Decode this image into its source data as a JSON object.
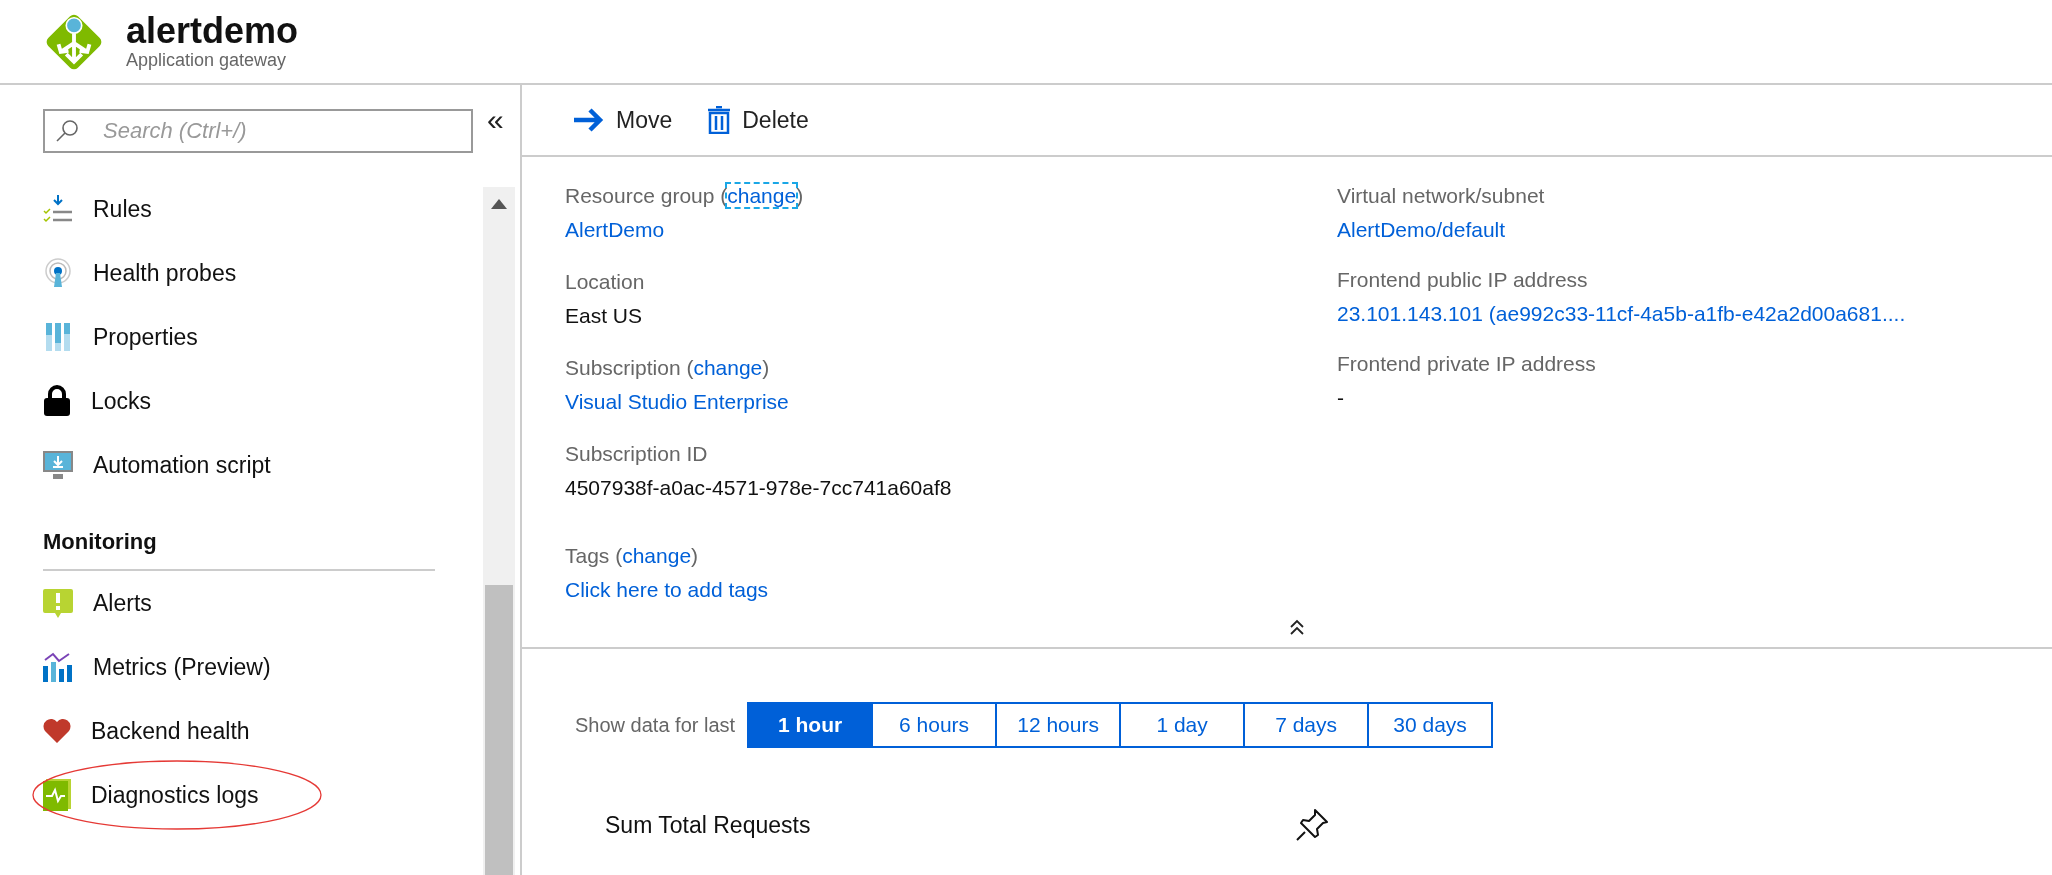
{
  "header": {
    "title": "alertdemo",
    "subtitle": "Application gateway"
  },
  "sidebar": {
    "search": {
      "placeholder": "Search (Ctrl+/)"
    },
    "collapse": "«",
    "items": [
      {
        "label": "Rules",
        "highlighted": false
      },
      {
        "label": "Health probes",
        "highlighted": false
      },
      {
        "label": "Properties",
        "highlighted": false
      },
      {
        "label": "Locks",
        "highlighted": false
      },
      {
        "label": "Automation script",
        "highlighted": false
      }
    ],
    "sections": [
      {
        "title": "Monitoring",
        "items": [
          {
            "label": "Alerts",
            "highlighted": false
          },
          {
            "label": "Metrics (Preview)",
            "highlighted": false
          },
          {
            "label": "Backend health",
            "highlighted": false
          },
          {
            "label": "Diagnostics logs",
            "highlighted": true
          }
        ]
      }
    ]
  },
  "toolbar": [
    {
      "label": "Move"
    },
    {
      "label": "Delete"
    }
  ],
  "essentials": {
    "left": [
      {
        "label": "Resource group (",
        "change": "change",
        "after": ")",
        "focused": true,
        "value": "AlertDemo",
        "link": true
      },
      {
        "label": "Location",
        "value": "East US",
        "link": false
      },
      {
        "label": "Subscription (",
        "change": "change",
        "after": ")",
        "focused": false,
        "value": "Visual Studio Enterprise",
        "link": true
      },
      {
        "label": "Subscription ID",
        "value": "4507938f-a0ac-4571-978e-7cc741a60af8",
        "link": false
      },
      {
        "label": "Tags (",
        "change": "change",
        "after": ")",
        "focused": false,
        "value": "Click here to add tags",
        "link": true
      }
    ],
    "right": [
      {
        "label": "Virtual network/subnet",
        "value": "AlertDemo/default",
        "link": true
      },
      {
        "label": "Frontend public IP address",
        "value": "23.101.143.101 (ae992c33-11cf-4a5b-a1fb-e42a2d00a681....",
        "link": true
      },
      {
        "label": "Frontend private IP address",
        "value": "-",
        "link": false
      }
    ]
  },
  "time_range": {
    "label": "Show data for last",
    "options": [
      {
        "label": "1 hour",
        "selected": true
      },
      {
        "label": "6 hours",
        "selected": false
      },
      {
        "label": "12 hours",
        "selected": false
      },
      {
        "label": "1 day",
        "selected": false
      },
      {
        "label": "7 days",
        "selected": false
      },
      {
        "label": "30 days",
        "selected": false
      }
    ]
  },
  "chart_card": {
    "title": "Sum Total Requests"
  }
}
